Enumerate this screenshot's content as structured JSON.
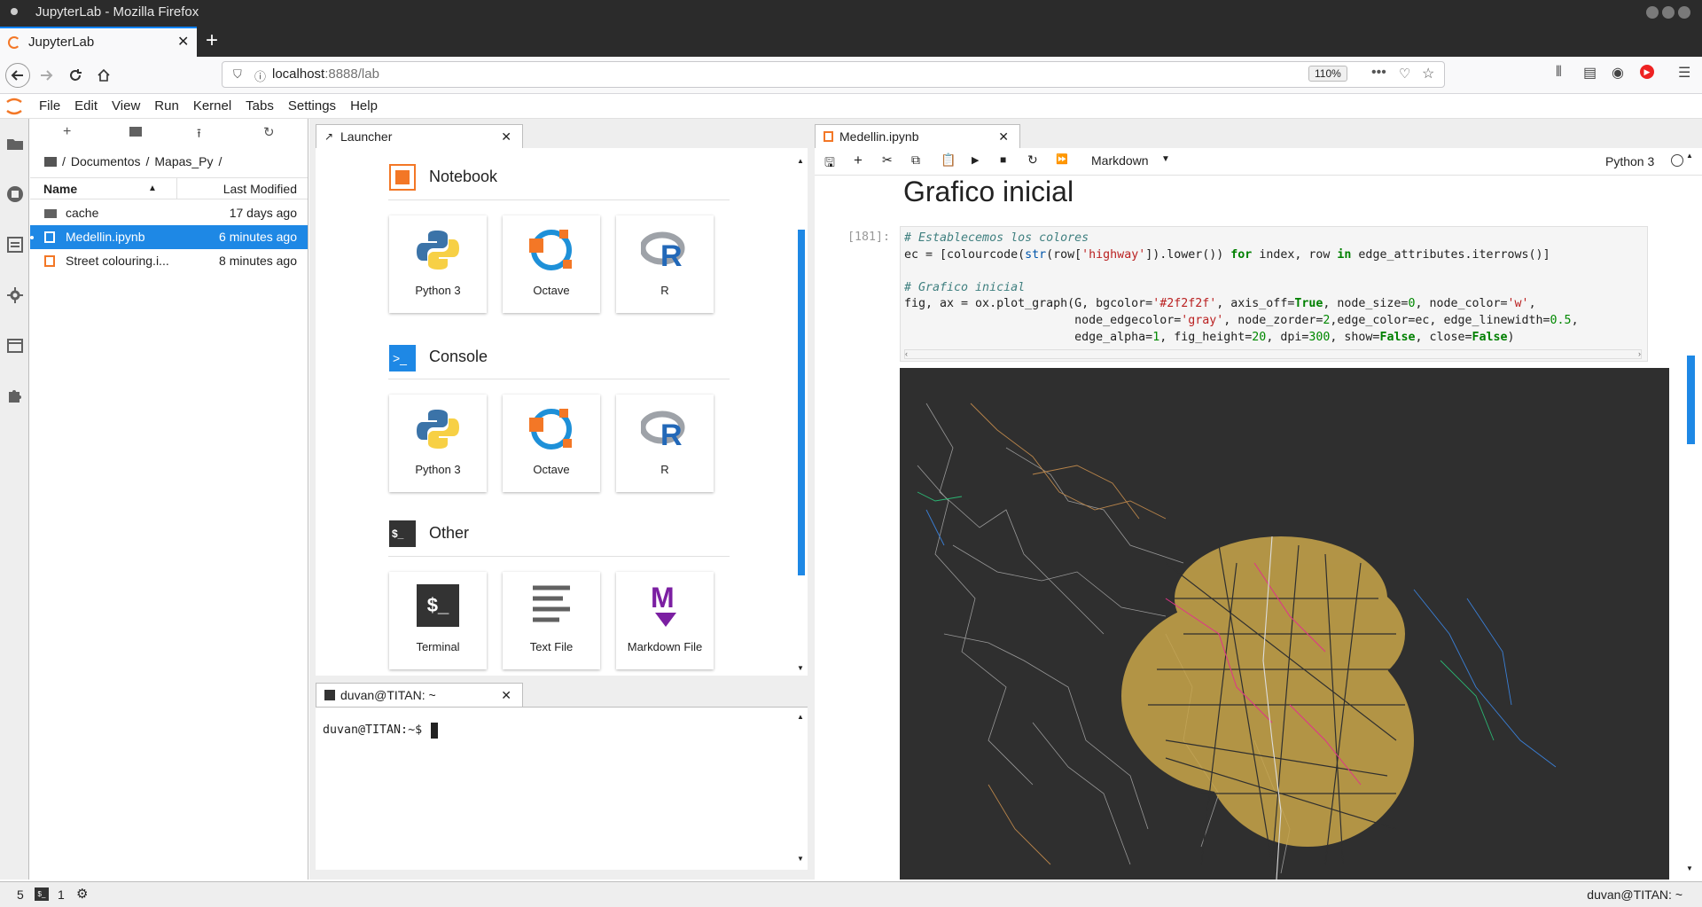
{
  "window": {
    "title": "JupyterLab - Mozilla Firefox"
  },
  "browser": {
    "tab_title": "JupyterLab",
    "url_host": "localhost",
    "url_rest": ":8888/lab",
    "zoom": "110%"
  },
  "menu": [
    "File",
    "Edit",
    "View",
    "Run",
    "Kernel",
    "Tabs",
    "Settings",
    "Help"
  ],
  "filebrowser": {
    "breadcrumb": [
      "Documentos",
      "Mapas_Py"
    ],
    "col_name": "Name",
    "col_modified": "Last Modified",
    "files": [
      {
        "name": "cache",
        "modified": "17 days ago",
        "type": "folder"
      },
      {
        "name": "Medellin.ipynb",
        "modified": "6 minutes ago",
        "type": "notebook"
      },
      {
        "name": "Street colouring.i...",
        "modified": "8 minutes ago",
        "type": "notebook"
      }
    ]
  },
  "launcher": {
    "tab_title": "Launcher",
    "sections": [
      {
        "title": "Notebook",
        "items": [
          "Python 3",
          "Octave",
          "R"
        ]
      },
      {
        "title": "Console",
        "items": [
          "Python 3",
          "Octave",
          "R"
        ]
      },
      {
        "title": "Other",
        "items": [
          "Terminal",
          "Text File",
          "Markdown File"
        ]
      }
    ]
  },
  "terminal": {
    "tab_title": "duvan@TITAN: ~",
    "prompt": "duvan@TITAN:~$ "
  },
  "notebook": {
    "tab_title": "Medellin.ipynb",
    "cell_type": "Markdown",
    "kernel": "Python 3",
    "heading": "Grafico inicial",
    "exec_count": "[181]:"
  },
  "status": {
    "left_num": "5",
    "term_count": "1",
    "right_text": "duvan@TITAN: ~"
  },
  "colors": {
    "jupyter_orange": "#f37726",
    "active_blue": "#1e88e5",
    "plot_bg": "#2f2f2f",
    "scroll_blue": "#1e88e5"
  }
}
